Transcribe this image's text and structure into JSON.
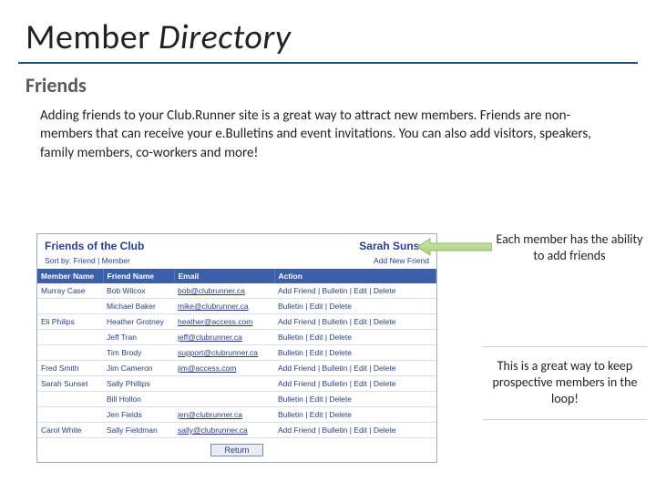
{
  "title": {
    "plain": "Member ",
    "italic": "Directory"
  },
  "subtitle": "Friends",
  "body": "Adding friends to your Club.Runner site is a great way to attract new members. Friends are non-members that can receive your e.Bulletins and event invitations. You can also add visitors, speakers, family members, co-workers and more!",
  "annot1": "Each member has the ability to add friends",
  "annot2": "This is a great way to keep prospective members in the loop!",
  "screenshot": {
    "heading_left": "Friends of the Club",
    "heading_right": "Sarah Sunset",
    "sort_label": "Sort by: Friend | Member",
    "add_label": "Add New Friend",
    "cols": {
      "member": "Member Name",
      "friend": "Friend Name",
      "email": "Email",
      "action": "Action"
    },
    "action_text": "Add Friend | Bulletin | Edit | Delete",
    "action_text_short": "Bulletin | Edit | Delete",
    "return_label": "Return",
    "rows": [
      {
        "member": "Murray Case",
        "friend": "Bob Wilcox",
        "email": "bob@clubrunner.ca",
        "new": true
      },
      {
        "member": "",
        "friend": "Michael Baker",
        "email": "mike@clubrunner.ca",
        "new": false
      },
      {
        "member": "Eli Philips",
        "friend": "Heather Grotney",
        "email": "heather@access.com",
        "new": true
      },
      {
        "member": "",
        "friend": "Jeff Tran",
        "email": "jeff@clubrunner.ca",
        "new": false
      },
      {
        "member": "",
        "friend": "Tim Brody",
        "email": "support@clubrunner.ca",
        "new": false
      },
      {
        "member": "Fred Smith",
        "friend": "Jim Cameron",
        "email": "jim@access.com",
        "new": true
      },
      {
        "member": "Sarah Sunset",
        "friend": "Sally Phillips",
        "email": "",
        "new": true
      },
      {
        "member": "",
        "friend": "Bill Hollon",
        "email": "",
        "new": false
      },
      {
        "member": "",
        "friend": "Jen Fields",
        "email": "jen@clubrunner.ca",
        "new": false
      },
      {
        "member": "Carol White",
        "friend": "Sally Fieldman",
        "email": "sally@clubrunner.ca",
        "new": true
      }
    ]
  }
}
